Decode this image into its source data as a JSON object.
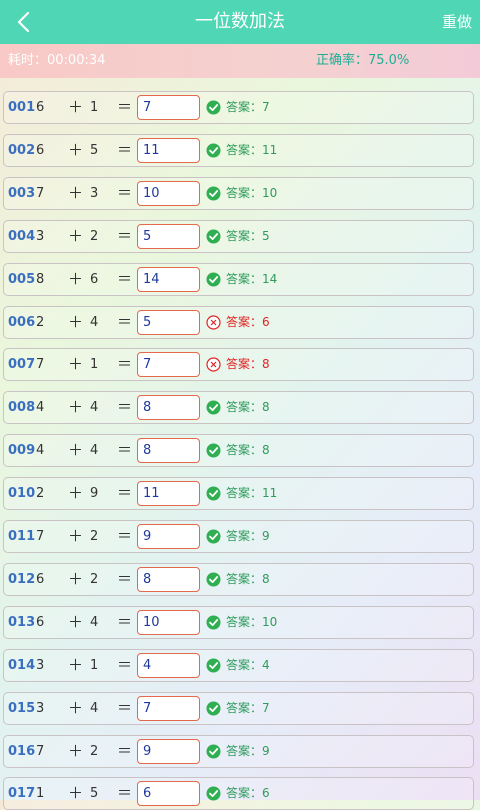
{
  "header": {
    "title": "一位数加法",
    "redo_label": "重做",
    "back_icon": "back-arrow-icon"
  },
  "status": {
    "elapsed": "耗时：00:00:34",
    "accuracy": "正确率：75.0%"
  },
  "colors": {
    "header": "#4fd6b4",
    "correct": "#2f9b5d",
    "wrong": "#e02424",
    "index": "#3a6fc0",
    "input_border": "#e2694a"
  },
  "problems": [
    {
      "idx": "001",
      "a": "6",
      "op": "＋",
      "b": "1",
      "eq": "＝",
      "input": "7",
      "correct": true,
      "answer": "答案：7"
    },
    {
      "idx": "002",
      "a": "6",
      "op": "＋",
      "b": "5",
      "eq": "＝",
      "input": "11",
      "correct": true,
      "answer": "答案：11"
    },
    {
      "idx": "003",
      "a": "7",
      "op": "＋",
      "b": "3",
      "eq": "＝",
      "input": "10",
      "correct": true,
      "answer": "答案：10"
    },
    {
      "idx": "004",
      "a": "3",
      "op": "＋",
      "b": "2",
      "eq": "＝",
      "input": "5",
      "correct": true,
      "answer": "答案：5"
    },
    {
      "idx": "005",
      "a": "8",
      "op": "＋",
      "b": "6",
      "eq": "＝",
      "input": "14",
      "correct": true,
      "answer": "答案：14"
    },
    {
      "idx": "006",
      "a": "2",
      "op": "＋",
      "b": "4",
      "eq": "＝",
      "input": "5",
      "correct": false,
      "answer": "答案：6"
    },
    {
      "idx": "007",
      "a": "7",
      "op": "＋",
      "b": "1",
      "eq": "＝",
      "input": "7",
      "correct": false,
      "answer": "答案：8"
    },
    {
      "idx": "008",
      "a": "4",
      "op": "＋",
      "b": "4",
      "eq": "＝",
      "input": "8",
      "correct": true,
      "answer": "答案：8"
    },
    {
      "idx": "009",
      "a": "4",
      "op": "＋",
      "b": "4",
      "eq": "＝",
      "input": "8",
      "correct": true,
      "answer": "答案：8"
    },
    {
      "idx": "010",
      "a": "2",
      "op": "＋",
      "b": "9",
      "eq": "＝",
      "input": "11",
      "correct": true,
      "answer": "答案：11"
    },
    {
      "idx": "011",
      "a": "7",
      "op": "＋",
      "b": "2",
      "eq": "＝",
      "input": "9",
      "correct": true,
      "answer": "答案：9"
    },
    {
      "idx": "012",
      "a": "6",
      "op": "＋",
      "b": "2",
      "eq": "＝",
      "input": "8",
      "correct": true,
      "answer": "答案：8"
    },
    {
      "idx": "013",
      "a": "6",
      "op": "＋",
      "b": "4",
      "eq": "＝",
      "input": "10",
      "correct": true,
      "answer": "答案：10"
    },
    {
      "idx": "014",
      "a": "3",
      "op": "＋",
      "b": "1",
      "eq": "＝",
      "input": "4",
      "correct": true,
      "answer": "答案：4"
    },
    {
      "idx": "015",
      "a": "3",
      "op": "＋",
      "b": "4",
      "eq": "＝",
      "input": "7",
      "correct": true,
      "answer": "答案：7"
    },
    {
      "idx": "016",
      "a": "7",
      "op": "＋",
      "b": "2",
      "eq": "＝",
      "input": "9",
      "correct": true,
      "answer": "答案：9"
    },
    {
      "idx": "017",
      "a": "1",
      "op": "＋",
      "b": "5",
      "eq": "＝",
      "input": "6",
      "correct": true,
      "answer": "答案：6"
    }
  ]
}
